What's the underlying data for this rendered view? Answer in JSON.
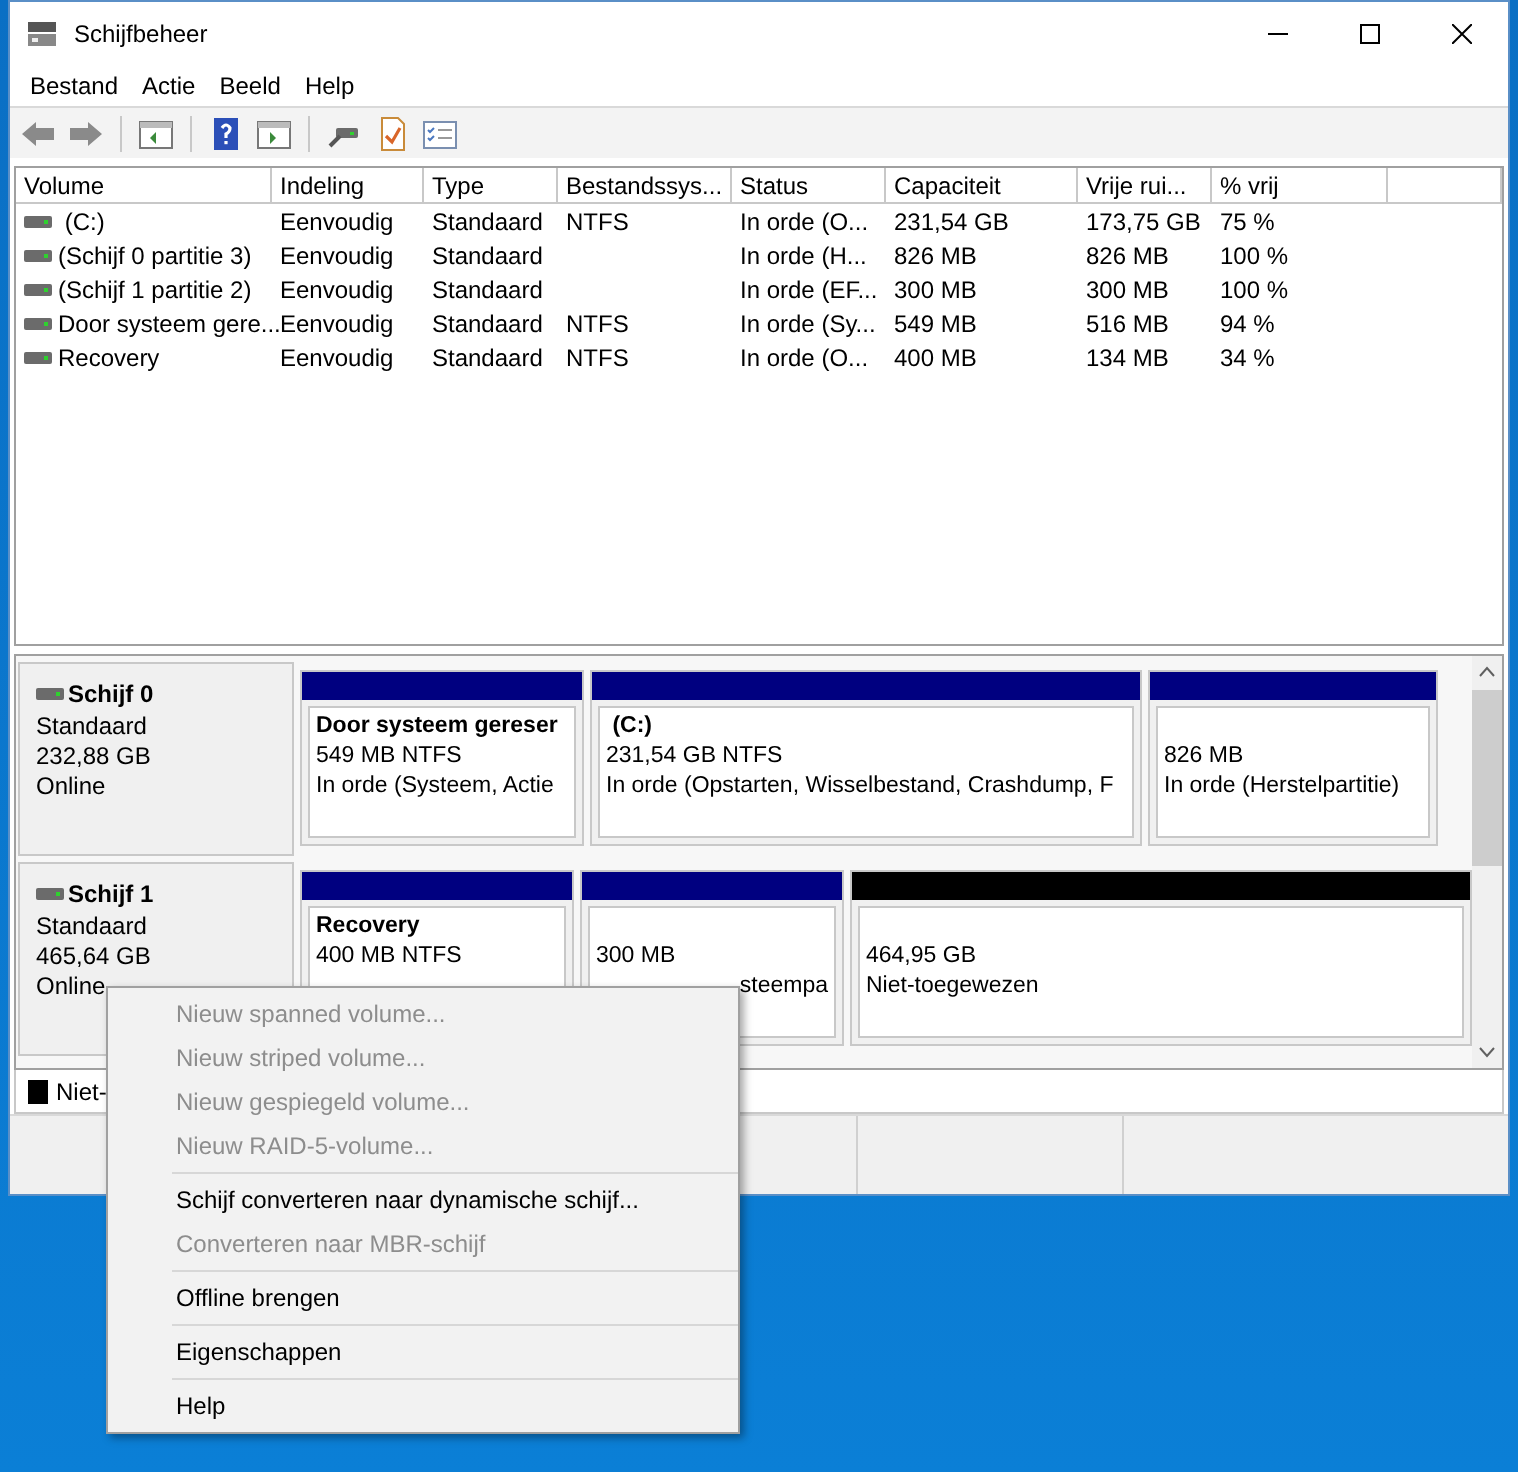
{
  "window": {
    "title": "Schijfbeheer"
  },
  "menu_bar": [
    "Bestand",
    "Actie",
    "Beeld",
    "Help"
  ],
  "table": {
    "columns": [
      "Volume",
      "Indeling",
      "Type",
      "Bestandssys...",
      "Status",
      "Capaciteit",
      "Vrije rui...",
      "% vrij"
    ],
    "rows": [
      {
        "cells": [
          " (C:)",
          "Eenvoudig",
          "Standaard",
          "NTFS",
          "In orde (O...",
          "231,54 GB",
          "173,75 GB",
          "75 %"
        ]
      },
      {
        "cells": [
          "(Schijf 0 partitie 3)",
          "Eenvoudig",
          "Standaard",
          "",
          "In orde (H...",
          "826 MB",
          "826 MB",
          "100 %"
        ]
      },
      {
        "cells": [
          "(Schijf 1 partitie 2)",
          "Eenvoudig",
          "Standaard",
          "",
          "In orde (EF...",
          "300 MB",
          "300 MB",
          "100 %"
        ]
      },
      {
        "cells": [
          "Door systeem gere...",
          "Eenvoudig",
          "Standaard",
          "NTFS",
          "In orde (Sy...",
          "549 MB",
          "516 MB",
          "94 %"
        ]
      },
      {
        "cells": [
          "Recovery",
          "Eenvoudig",
          "Standaard",
          "NTFS",
          "In orde (O...",
          "400 MB",
          "134 MB",
          "34 %"
        ]
      }
    ]
  },
  "disks": [
    {
      "name": "Schijf 0",
      "lines": [
        "Standaard",
        "232,88 GB",
        "Online"
      ],
      "partitions": [
        {
          "color": "#000080",
          "title": "Door systeem gereser",
          "lines": [
            "549 MB NTFS",
            "In orde (Systeem, Actie"
          ]
        },
        {
          "color": "#000080",
          "title": " (C:)",
          "lines": [
            "231,54 GB NTFS",
            "In orde (Opstarten, Wisselbestand, Crashdump, F"
          ]
        },
        {
          "color": "#000080",
          "lines": [
            "826 MB",
            "In orde (Herstelpartitie)"
          ]
        }
      ]
    },
    {
      "name": "Schijf 1",
      "lines": [
        "Standaard",
        "465,64 GB",
        "Online"
      ],
      "partitions": [
        {
          "color": "#000080",
          "title": "Recovery",
          "lines": [
            "400 MB NTFS"
          ]
        },
        {
          "color": "#000080",
          "lines": [
            "300 MB"
          ],
          "tail": "steempa"
        },
        {
          "color": "#000000",
          "lines": [
            "464,95 GB",
            "Niet-toegewezen"
          ]
        }
      ]
    }
  ],
  "legend": [
    {
      "color": "#000000",
      "label": "Niet-"
    }
  ],
  "context_menu": {
    "groups": [
      {
        "items": [
          {
            "label": "Nieuw spanned volume...",
            "disabled": true
          },
          {
            "label": "Nieuw striped volume...",
            "disabled": true
          },
          {
            "label": "Nieuw gespiegeld volume...",
            "disabled": true
          },
          {
            "label": "Nieuw RAID-5-volume...",
            "disabled": true
          }
        ]
      },
      {
        "items": [
          {
            "label": "Schijf converteren naar dynamische schijf...",
            "disabled": false
          },
          {
            "label": "Converteren naar MBR-schijf",
            "disabled": true
          }
        ]
      },
      {
        "items": [
          {
            "label": "Offline brengen",
            "disabled": false
          }
        ]
      },
      {
        "items": [
          {
            "label": "Eigenschappen",
            "disabled": false
          }
        ]
      },
      {
        "items": [
          {
            "label": "Help",
            "disabled": false
          }
        ]
      }
    ]
  }
}
